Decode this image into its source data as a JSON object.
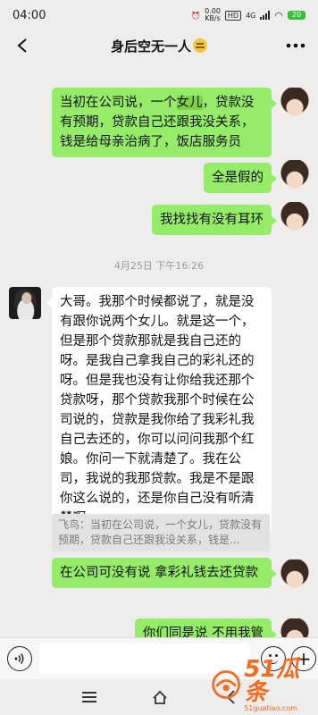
{
  "status_bar": {
    "time": "04:00",
    "net_speed": "0.00",
    "net_unit": "KB/s",
    "badge_1": "HD",
    "net_type": "4G",
    "battery": "20"
  },
  "header": {
    "title": "身后空无一人",
    "title_emoji": "pensive-face-emoji"
  },
  "messages": [
    {
      "sender": "me",
      "text_before": "当初在公司说，一个",
      "highlight": "女儿",
      "text_after": "，贷款没有预期，贷款自己还跟我没关系，钱是给母亲治病了，饭店服务员"
    },
    {
      "sender": "me",
      "text": "全是假的"
    },
    {
      "sender": "me",
      "text": "我找找有没有耳环"
    },
    {
      "sender": "system",
      "text": "4月25日 下午16:26"
    },
    {
      "sender": "other",
      "text": "大哥。我那个时候都说了，就是没有跟你说两个女儿。就是这一个，但是那个贷款那就是我自己还的呀。是我自己拿我自己的彩礼还的呀。但是我也没有让你给我还那个贷款呀，那个贷款我那个时候在公司说的，贷款是我你给了我彩礼我自己去还的，你可以问问我那个红娘。你问一下就清楚了。我在公司，我说的我那贷款。我是不是跟你这么说的，还是你自己没有听清楚啊"
    },
    {
      "sender": "quote",
      "text": "飞鸟：当初在公司说，一个女儿，贷款没有预期，贷款自己还跟我没关系，钱是..."
    },
    {
      "sender": "me",
      "text": "在公司可没有说  拿彩礼钱去还贷款"
    },
    {
      "sender": "me",
      "text": "你们同是说  不用我管"
    }
  ],
  "input_bar": {
    "voice_icon": "voice-icon",
    "emoji_icon": "emoji-icon",
    "plus_icon": "plus-icon"
  },
  "watermark": {
    "brand": "51瓜条",
    "url": "51guatiao.com"
  },
  "colors": {
    "my_bubble": "#95ec69",
    "other_bubble": "#ffffff",
    "background": "#ededed",
    "watermark": "#f36d21"
  }
}
